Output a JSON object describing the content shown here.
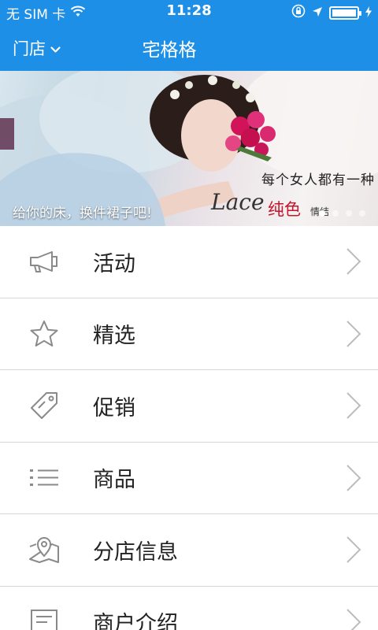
{
  "status_bar": {
    "carrier": "无 SIM 卡",
    "time": "11:28",
    "battery_level": 1.0
  },
  "header": {
    "store_label": "门店",
    "title": "宅格格"
  },
  "banner": {
    "caption": "给你的床，换件裙子吧!",
    "overlay_text": "每个女人都有一种",
    "lace_text": "Lace",
    "pure_text": "纯色",
    "emotion_text": "情结",
    "dots_count": 4,
    "active_dot": 0
  },
  "menu": {
    "items": [
      {
        "label": "活动",
        "icon": "megaphone-icon"
      },
      {
        "label": "精选",
        "icon": "star-icon"
      },
      {
        "label": "促销",
        "icon": "tag-icon"
      },
      {
        "label": "商品",
        "icon": "list-icon"
      },
      {
        "label": "分店信息",
        "icon": "map-pin-icon"
      },
      {
        "label": "商户介绍",
        "icon": "document-icon"
      }
    ]
  },
  "colors": {
    "accent": "#1e8fe6",
    "divider": "#d6d6d6",
    "icon": "#8a8a8a",
    "text": "#222222",
    "banner_red": "#c8132a"
  }
}
